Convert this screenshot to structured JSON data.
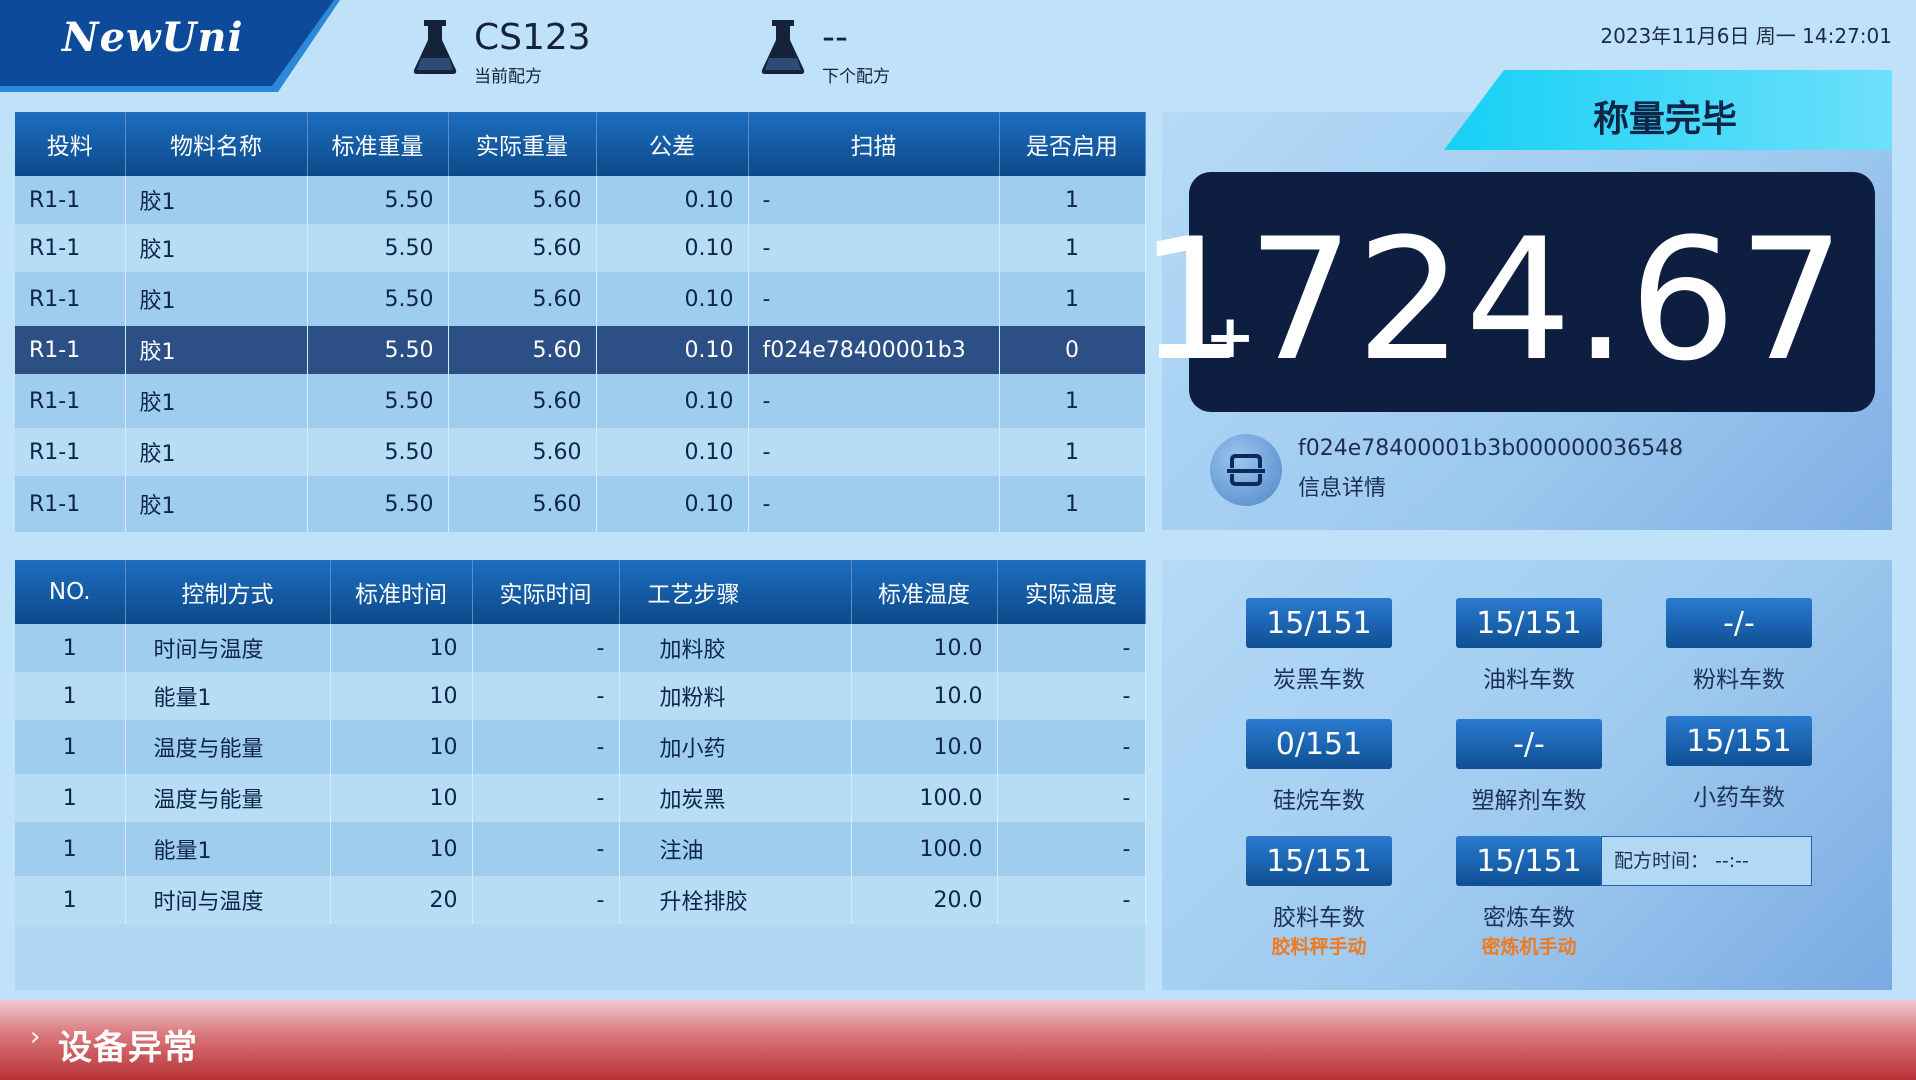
{
  "brand": {
    "logo_text": "NewUni"
  },
  "header": {
    "current_recipe": {
      "value": "CS123",
      "label": "当前配方"
    },
    "next_recipe": {
      "value": "--",
      "label": "下个配方"
    },
    "datetime": "2023年11月6日  周一  14:27:01"
  },
  "material_table": {
    "columns": [
      "投料",
      "物料名称",
      "标准重量",
      "实际重量",
      "公差",
      "扫描",
      "是否启用"
    ],
    "rows": [
      [
        "R1-1",
        "胶1",
        "5.50",
        "5.60",
        "0.10",
        "-",
        "1"
      ],
      [
        "R1-1",
        "胶1",
        "5.50",
        "5.60",
        "0.10",
        "-",
        "1"
      ],
      [
        "R1-1",
        "胶1",
        "5.50",
        "5.60",
        "0.10",
        "-",
        "1"
      ],
      [
        "R1-1",
        "胶1",
        "5.50",
        "5.60",
        "0.10",
        "f024e78400001b3",
        "0"
      ],
      [
        "R1-1",
        "胶1",
        "5.50",
        "5.60",
        "0.10",
        "-",
        "1"
      ],
      [
        "R1-1",
        "胶1",
        "5.50",
        "5.60",
        "0.10",
        "-",
        "1"
      ],
      [
        "R1-1",
        "胶1",
        "5.50",
        "5.60",
        "0.10",
        "-",
        "1"
      ]
    ],
    "selected_row": 3
  },
  "process_table": {
    "columns": [
      "NO.",
      "控制方式",
      "标准时间",
      "实际时间",
      "工艺步骤",
      "标准温度",
      "实际温度"
    ],
    "rows": [
      [
        "1",
        "时间与温度",
        "10",
        "-",
        "加料胶",
        "10.0",
        "-"
      ],
      [
        "1",
        "能量1",
        "10",
        "-",
        "加粉料",
        "10.0",
        "-"
      ],
      [
        "1",
        "温度与能量",
        "10",
        "-",
        "加小药",
        "10.0",
        "-"
      ],
      [
        "1",
        "温度与能量",
        "10",
        "-",
        "加炭黑",
        "100.0",
        "-"
      ],
      [
        "1",
        "能量1",
        "10",
        "-",
        "注油",
        "100.0",
        "-"
      ],
      [
        "1",
        "时间与温度",
        "20",
        "-",
        "升栓排胶",
        "20.0",
        "-"
      ]
    ]
  },
  "weighing": {
    "status": "称量完毕",
    "sign": "+",
    "value": "1724.67",
    "scan_code": "f024e78400001b3b000000036548",
    "detail_label": "信息详情"
  },
  "counters": {
    "carbon_black": {
      "value": "15/151",
      "label": "炭黑车数"
    },
    "oil": {
      "value": "15/151",
      "label": "油料车数"
    },
    "powder": {
      "value": "-/-",
      "label": "粉料车数"
    },
    "silane": {
      "value": "0/151",
      "label": "硅烷车数"
    },
    "plasticizer": {
      "value": "-/-",
      "label": "塑解剂车数"
    },
    "small_drug": {
      "value": "15/151",
      "label": "小药车数"
    },
    "rubber": {
      "value": "15/151",
      "label": "胶料车数",
      "mode": "胶料秤手动"
    },
    "mixer": {
      "value": "15/151",
      "label": "密炼车数",
      "mode": "密炼机手动"
    },
    "recipe_time": "配方时间：  --:--"
  },
  "footer": {
    "alarm": "设备异常"
  },
  "colors": {
    "header_blue": "#0d4a8a",
    "accent_cyan": "#1ad6f5",
    "display_bg": "#0e1e40",
    "alarm_red": "#b63337",
    "mode_orange": "#f07a1f"
  },
  "icons": [
    "flask-icon",
    "scan-icon",
    "chevron-right-icon"
  ]
}
